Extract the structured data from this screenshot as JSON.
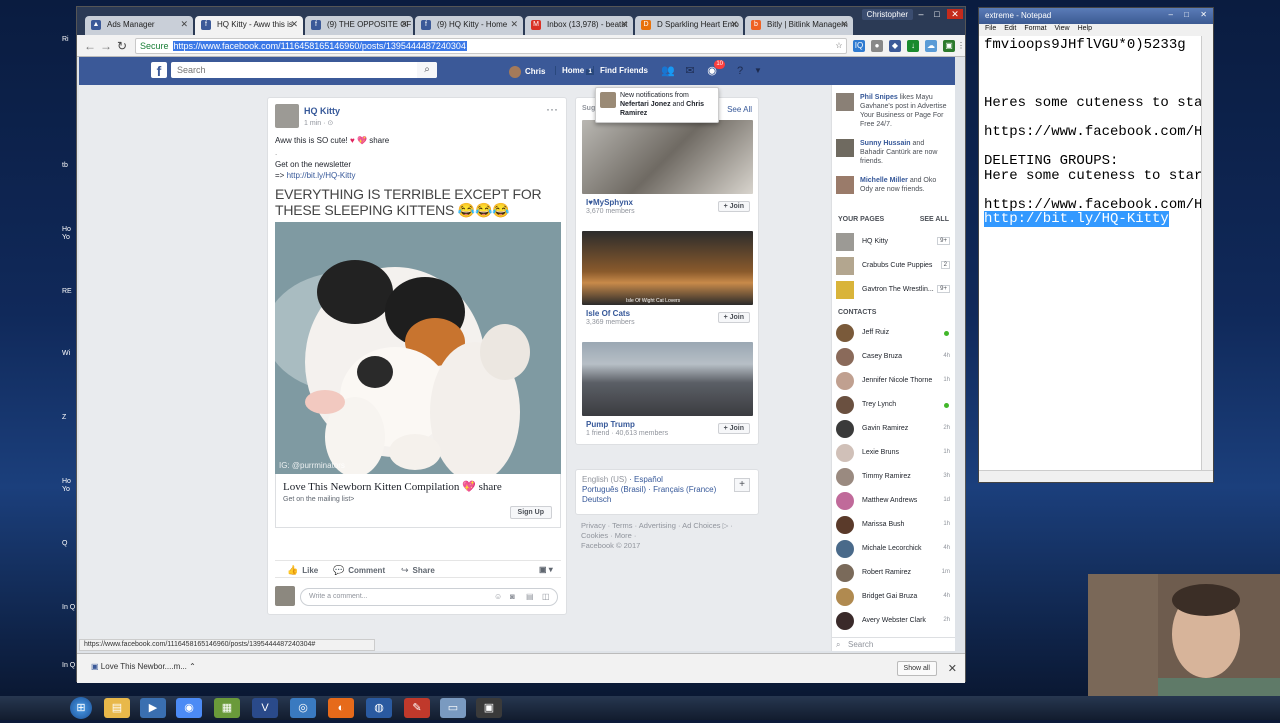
{
  "desktop": {
    "icons": [
      "Ri",
      "tb",
      "Ho Yo",
      "RE",
      "Wi",
      "Z",
      "Ho Yo",
      "Q",
      "In Q",
      "In Q"
    ]
  },
  "browser": {
    "user": "Christopher",
    "tabs": [
      {
        "label": "Ads Manager"
      },
      {
        "label": "HQ Kitty - Aww this is"
      },
      {
        "label": "(9) THE OPPOSITE OF"
      },
      {
        "label": "(9) HQ Kitty - Home"
      },
      {
        "label": "Inbox (13,978) - beatst"
      },
      {
        "label": "D Sparkling Heart Emo"
      },
      {
        "label": "Bitly | Bitlink Managem"
      }
    ],
    "secure_label": "Secure",
    "url": "https://www.facebook.com/1116458165146960/posts/1395444487240304",
    "status_url": "https://www.facebook.com/1116458165146960/posts/1395444487240304#"
  },
  "facebook": {
    "search_placeholder": "Search",
    "nav": {
      "user": "Chris",
      "home": "Home",
      "home_count": "1",
      "find_friends": "Find Friends",
      "notif_count": "10"
    },
    "notification": {
      "prefix": "New notifications from",
      "name1": "Nefertari Jonez",
      "and": "and",
      "name2": "Chris Ramirez"
    },
    "post": {
      "page_name": "HQ Kitty",
      "time": "1 min",
      "text_line1": "Aww this is SO cute!",
      "text_share": "share",
      "dot": ".",
      "newsletter": "Get on the newsletter",
      "arrow": "=>",
      "link": "http://bit.ly/HQ-Kitty",
      "image_caption": "EVERYTHING IS TERRIBLE EXCEPT FOR THESE SLEEPING KITTENS 😂😂😂",
      "watermark": "IG: @purrminators",
      "card_title": "Love This Newborn Kitten Compilation 💖 share",
      "card_sub": "Get on the mailing list>",
      "signup": "Sign Up",
      "like": "Like",
      "comment": "Comment",
      "share": "Share",
      "comment_placeholder": "Write a comment..."
    },
    "groups": {
      "header": "Sug",
      "see_all": "See All",
      "items": [
        {
          "name": "I♥MySphynx",
          "members": "3,670 members",
          "join": "+ Join"
        },
        {
          "name": "Isle Of Cats",
          "members": "3,369 members",
          "join": "+ Join",
          "img_caption": "Isle Of Wight Cat Lovers"
        },
        {
          "name": "Pump Trump",
          "members": "1 friend · 40,613 members",
          "join": "+ Join"
        }
      ]
    },
    "languages": {
      "l1": "English (US)",
      "l2": "Español",
      "l3": "Português (Brasil)",
      "l4": "Français (France)",
      "l5": "Deutsch",
      "plus": "+"
    },
    "footer": {
      "links": "Privacy · Terms · Advertising · Ad Choices ▷ · Cookies · More ·",
      "copyright": "Facebook © 2017"
    },
    "ticker": [
      {
        "name": "Phil Snipes",
        "text": "likes Mayu Gavhane's post in Advertise Your Business or Page For Free 24/7."
      },
      {
        "name": "Sunny Hussain",
        "text": "and Bahadir Cantürk are now friends."
      },
      {
        "name": "Michelle Miller",
        "text": "and Oko Ody are now friends."
      }
    ],
    "your_pages": {
      "header": "YOUR PAGES",
      "see_all": "SEE ALL",
      "items": [
        {
          "name": "HQ Kitty",
          "count": "9+"
        },
        {
          "name": "Crabubs Cute Puppies",
          "count": "2"
        },
        {
          "name": "Gavtron The Wrestlin...",
          "count": "9+"
        }
      ]
    },
    "contacts": {
      "header": "CONTACTS",
      "items": [
        {
          "name": "Jeff Ruiz",
          "status": ""
        },
        {
          "name": "Casey Bruza",
          "status": "4h"
        },
        {
          "name": "Jennifer Nicole Thorne",
          "status": "1h"
        },
        {
          "name": "Trey Lynch",
          "status": ""
        },
        {
          "name": "Gavin Ramirez",
          "status": "2h"
        },
        {
          "name": "Lexie Bruns",
          "status": "1h"
        },
        {
          "name": "Timmy Ramirez",
          "status": "3h"
        },
        {
          "name": "Matthew Andrews",
          "status": "1d"
        },
        {
          "name": "Marissa Bush",
          "status": "1h"
        },
        {
          "name": "Michale Lecorchick",
          "status": "4h"
        },
        {
          "name": "Robert Ramirez",
          "status": "1m"
        },
        {
          "name": "Bridget Gai Bruza",
          "status": "4h"
        },
        {
          "name": "Avery Webster Clark",
          "status": "2h"
        }
      ],
      "search_placeholder": "Search"
    }
  },
  "downloads": {
    "file": "Love This Newbor....m...",
    "show_all": "Show all"
  },
  "notepad": {
    "title": "extreme - Notepad",
    "menu": [
      "File",
      "Edit",
      "Format",
      "View",
      "Help"
    ],
    "line1": "fmvioops9JHflVGU*0)5233g",
    "line2": "Heres some cuteness to sta",
    "line3": "https://www.facebook.com/H",
    "line4": "DELETING GROUPS:",
    "line5": "Here some cuteness to star",
    "line6": "https://www.facebook.com/H",
    "line7": "http://bit.ly/HQ-Kitty"
  },
  "colors": {
    "fb_blue": "#3b5998",
    "link": "#365899",
    "online": "#42b72a",
    "notif": "#fa3e3e"
  }
}
